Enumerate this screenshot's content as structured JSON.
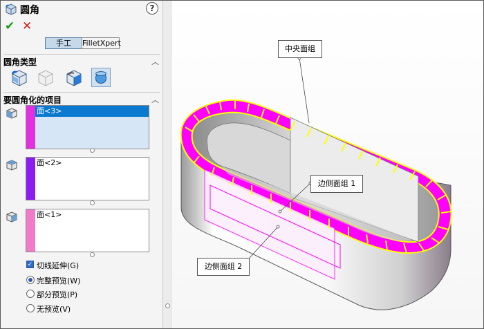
{
  "header": {
    "title": "圆角",
    "help": "?"
  },
  "actions": {
    "ok": "✔",
    "cancel": "✕"
  },
  "tabs": [
    {
      "label": "手工",
      "active": true
    },
    {
      "label": "FilletXpert",
      "active": false
    }
  ],
  "fillet_type": {
    "heading": "圆角类型",
    "collapse": "︿"
  },
  "items": {
    "heading": "要圆角化的项目",
    "collapse": "︿",
    "lists": [
      {
        "color": "#e030e0",
        "entry": "面<3>",
        "selected": true
      },
      {
        "color": "#8a1ef0",
        "entry": "面<2>",
        "selected": false
      },
      {
        "color": "#f07cc8",
        "entry": "面<1>",
        "selected": false
      }
    ]
  },
  "options": {
    "tangent": {
      "label": "切线延伸(G)",
      "checked": true
    },
    "preview": [
      {
        "label": "完整预览(W)",
        "checked": true
      },
      {
        "label": "部分预览(P)",
        "checked": false
      },
      {
        "label": "无预览(V)",
        "checked": false
      }
    ]
  },
  "callouts": {
    "center": "中央面组",
    "side1": "边侧面组  1",
    "side2": "边侧面组  2"
  },
  "colors": {
    "highlight": "#ff00ff",
    "edge": "#ffff00",
    "accent": "#0a79d0"
  }
}
